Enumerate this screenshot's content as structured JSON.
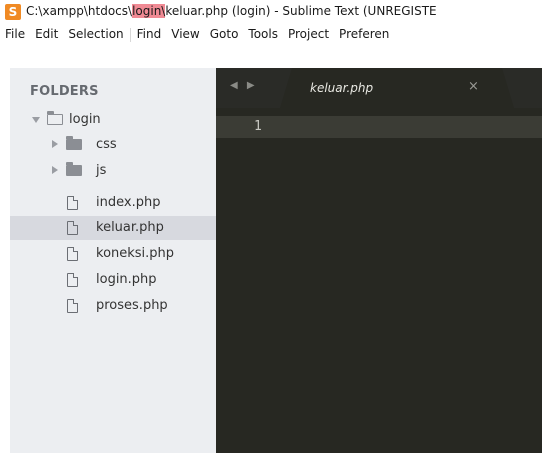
{
  "window": {
    "title_prefix": "C:\\xampp\\htdocs\\",
    "title_highlight": "login\\",
    "title_rest": "keluar.php (login) - Sublime Text (UNREGISTE",
    "app_icon": "S"
  },
  "menu": {
    "items": [
      "File",
      "Edit",
      "Selection",
      "Find",
      "View",
      "Goto",
      "Tools",
      "Project",
      "Preferen"
    ]
  },
  "sidebar": {
    "heading": "FOLDERS",
    "root_folder": "login",
    "subfolders": [
      "css",
      "js"
    ],
    "files": [
      "index.php",
      "keluar.php",
      "koneksi.php",
      "login.php",
      "proses.php"
    ],
    "selected_file": "keluar.php"
  },
  "editor": {
    "nav_arrows": "◀ ▶",
    "tab_label": "keluar.php",
    "tab_close": "×",
    "line_numbers": [
      "1"
    ]
  },
  "colors": {
    "sidebar_bg": "#eceef1",
    "selected_row": "#d7d9df",
    "editor_bg": "#272822",
    "title_highlight": "#f08a94"
  }
}
